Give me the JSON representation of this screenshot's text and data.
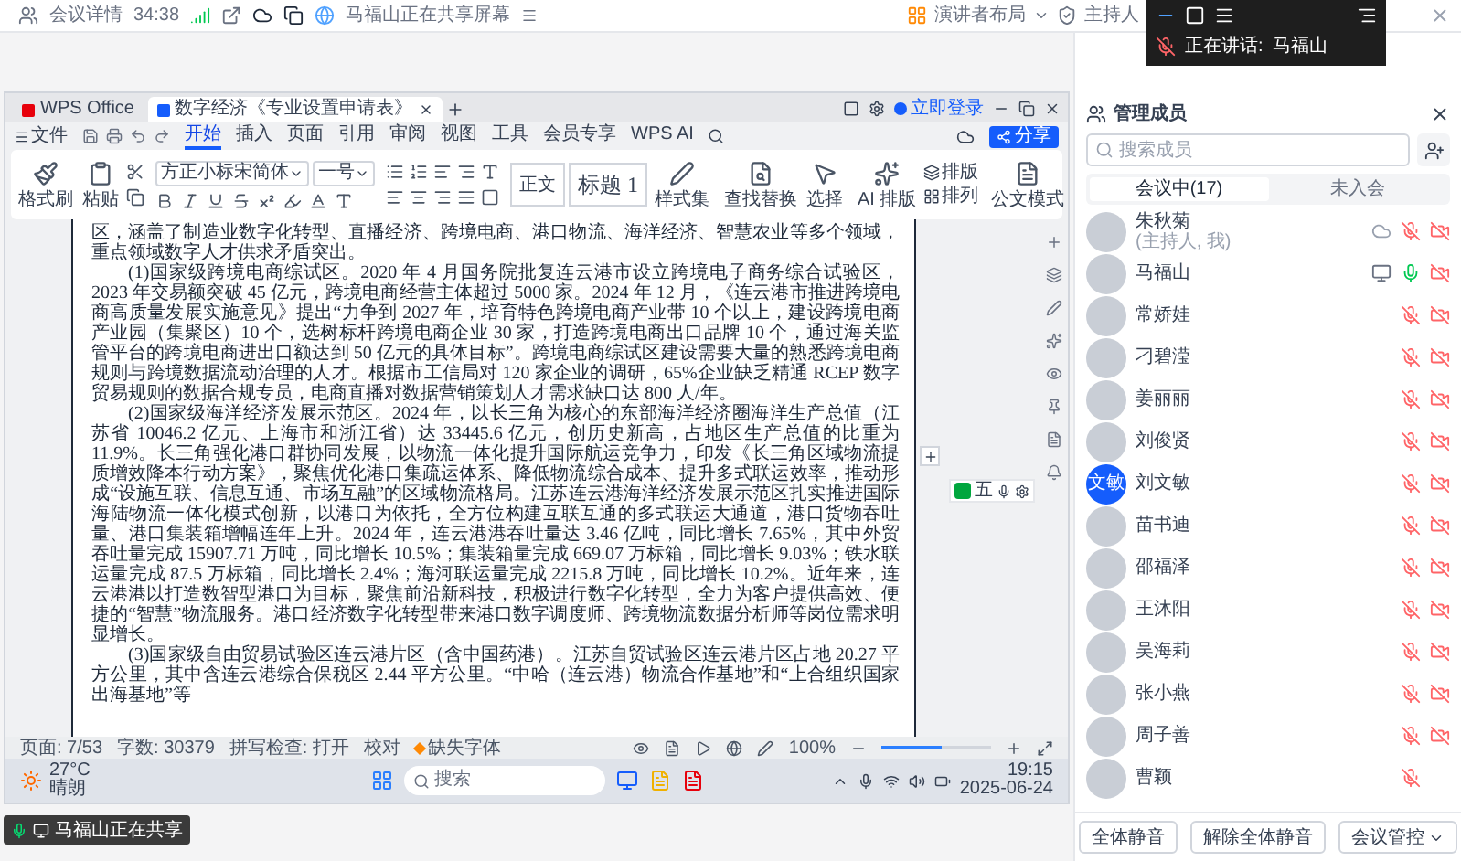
{
  "meeting_bar": {
    "title": "会议详情",
    "timer": "34:38",
    "sharing_notice": "马福山正在共享屏幕",
    "layout_button": "演讲者布局",
    "host_button": "主持人"
  },
  "speaking_overlay": {
    "label": "正在讲话:",
    "speaker": "马福山",
    "speaker_mic_on": false
  },
  "wps": {
    "tabs": [
      {
        "label": "WPS Office",
        "kind": "home",
        "selected": false
      },
      {
        "label": "数字经济《专业设置申请表》",
        "kind": "doc",
        "selected": true
      }
    ],
    "login": "立即登录",
    "file_menu": "文件",
    "menu": [
      {
        "label": "开始",
        "selected": true
      },
      {
        "label": "插入",
        "selected": false
      },
      {
        "label": "页面",
        "selected": false
      },
      {
        "label": "引用",
        "selected": false
      },
      {
        "label": "审阅",
        "selected": false
      },
      {
        "label": "视图",
        "selected": false
      },
      {
        "label": "工具",
        "selected": false
      },
      {
        "label": "会员专享",
        "selected": false
      },
      {
        "label": "WPS AI",
        "selected": false
      }
    ],
    "share_button": "分享",
    "ribbon": {
      "format_painter": "格式刷",
      "paste": "粘贴",
      "font": "方正小标宋简体",
      "font_size": "一号",
      "styles": [
        "正文",
        "标题 1"
      ],
      "style_set": "样式集",
      "find_replace": "查找替换",
      "select": "选择",
      "ai_layout": "AI 排版",
      "typeset": "排版",
      "arrange": "排列",
      "official_mode": "公文模式"
    },
    "document": {
      "paragraphs": [
        {
          "indent": false,
          "text": "区，涵盖了制造业数字化转型、直播经济、跨境电商、港口物流、海洋经济、智慧农业等多个领域，重点领域数字人才供求矛盾突出。"
        },
        {
          "indent": true,
          "text": "(1)国家级跨境电商综试区。2020 年 4 月国务院批复连云港市设立跨境电子商务综合试验区，2023 年交易额突破 45 亿元，跨境电商经营主体超过 5000 家。2024 年 12 月，《连云港市推进跨境电商高质量发展实施意见》提出“力争到 2027 年，培育特色跨境电商产业带 10 个以上，建设跨境电商产业园（集聚区）10 个，选树标杆跨境电商企业 30 家，打造跨境电商出口品牌 10 个，通过海关监管平台的跨境电商进出口额达到 50 亿元的具体目标”。跨境电商综试区建设需要大量的熟悉跨境电商规则与跨境数据流动治理的人才。根据市工信局对 120 家企业的调研，65%企业缺乏精通 RCEP 数字贸易规则的数据合规专员，电商直播对数据营销策划人才需求缺口达 800 人/年。"
        },
        {
          "indent": true,
          "text": "(2)国家级海洋经济发展示范区。2024 年，以长三角为核心的东部海洋经济圈海洋生产总值（江苏省 10046.2 亿元、上海市和浙江省）达 33445.6 亿元，创历史新高，占地区生产总值的比重为 11.9%。长三角强化港口群协同发展，以物流一体化提升国际航运竞争力，印发《长三角区域物流提质增效降本行动方案》，聚焦优化港口集疏运体系、降低物流综合成本、提升多式联运效率，推动形成“设施互联、信息互通、市场互融”的区域物流格局。江苏连云港海洋经济发展示范区扎实推进国际海陆物流一体化模式创新，以港口为依托，全方位构建互联互通的多式联运大通道，港口货物吞吐量、港口集装箱增幅连年上升。2024 年，连云港港吞吐量达 3.46 亿吨，同比增长 7.65%，其中外贸吞吐量完成 15907.71 万吨，同比增长 10.5%；集装箱量完成 669.07 万标箱，同比增长 9.03%；铁水联运量完成 87.5 万标箱，同比增长 2.4%；海河联运量完成 2215.8 万吨，同比增长 10.2%。近年来，连云港港以打造数智型港口为目标，聚焦前沿新科技，积极进行数字化转型，全力为客户提供高效、便捷的“智慧”物流服务。港口经济数字化转型带来港口数字调度师、跨境物流数据分析师等岗位需求明显增长。"
        },
        {
          "indent": true,
          "text": "(3)国家级自由贸易试验区连云港片区（含中国药港）。江苏自贸试验区连云港片区占地 20.27 平方公里，其中含连云港综合保税区 2.44 平方公里。“中哈（连云港）物流合作基地”和“上合组织国家出海基地”等"
        }
      ]
    },
    "ime_toolbar": {
      "label": "五"
    },
    "status_bar": {
      "page": "页面: 7/53",
      "words": "字数: 30379",
      "spell_check": "拼写检查: 打开",
      "proofread": "校对",
      "missing_fonts": "缺失字体",
      "zoom": "100%",
      "zoom_slider": {
        "level": 0.55
      }
    }
  },
  "taskbar": {
    "temperature": "27°C",
    "weather": "晴朗",
    "search_placeholder": "搜索",
    "time": "19:15",
    "date": "2025-06-24"
  },
  "share_badge": "马福山正在共享",
  "members_panel": {
    "title": "管理成员",
    "search_placeholder": "搜索成员",
    "tabs": [
      {
        "label": "会议中(17)",
        "selected": true
      },
      {
        "label": "未入会",
        "selected": false
      }
    ],
    "members": [
      {
        "name": "朱秋菊",
        "role": "(主持人, 我)",
        "recording": true,
        "sharing_screen": false,
        "mic_on": false,
        "camera_off": true
      },
      {
        "name": "马福山",
        "recording": false,
        "sharing_screen": true,
        "mic_on": true,
        "camera_off": true
      },
      {
        "name": "常娇娃",
        "recording": false,
        "sharing_screen": false,
        "mic_on": false,
        "camera_off": true
      },
      {
        "name": "刁碧滢",
        "recording": false,
        "sharing_screen": false,
        "mic_on": false,
        "camera_off": true
      },
      {
        "name": "姜丽丽",
        "recording": false,
        "sharing_screen": false,
        "mic_on": false,
        "camera_off": true
      },
      {
        "name": "刘俊贤",
        "recording": false,
        "sharing_screen": false,
        "mic_on": false,
        "camera_off": true
      },
      {
        "name": "刘文敏",
        "avatar_text": "文敏",
        "recording": false,
        "sharing_screen": false,
        "mic_on": false,
        "camera_off": true
      },
      {
        "name": "苗书迪",
        "recording": false,
        "sharing_screen": false,
        "mic_on": false,
        "camera_off": true
      },
      {
        "name": "邵福泽",
        "recording": false,
        "sharing_screen": false,
        "mic_on": false,
        "camera_off": true
      },
      {
        "name": "王沐阳",
        "recording": false,
        "sharing_screen": false,
        "mic_on": false,
        "camera_off": true
      },
      {
        "name": "吴海莉",
        "recording": false,
        "sharing_screen": false,
        "mic_on": false,
        "camera_off": true
      },
      {
        "name": "张小燕",
        "recording": false,
        "sharing_screen": false,
        "mic_on": false,
        "camera_off": true
      },
      {
        "name": "周子善",
        "recording": false,
        "sharing_screen": false,
        "mic_on": false,
        "camera_off": true
      },
      {
        "name": "曹颖",
        "recording": false,
        "sharing_screen": false,
        "mic_on": false,
        "camera_off": false
      }
    ],
    "buttons": [
      {
        "label": "全体静音",
        "kind": "plain"
      },
      {
        "label": "解除全体静音",
        "kind": "plain"
      },
      {
        "label": "会议管控",
        "kind": "dropdown"
      }
    ]
  }
}
